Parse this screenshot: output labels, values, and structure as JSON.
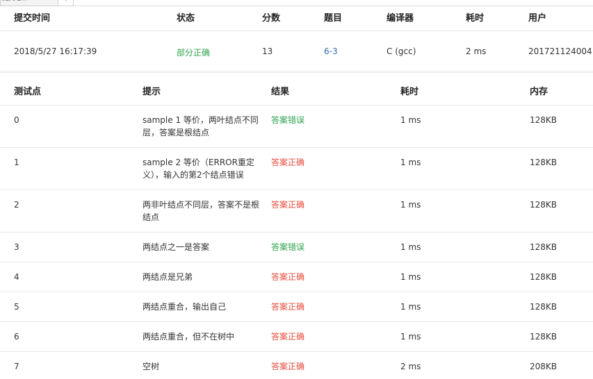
{
  "tab": {
    "label": "提交结果",
    "arrow": "‹"
  },
  "summary": {
    "headers": {
      "time": "提交时间",
      "status": "状态",
      "score": "分数",
      "problem": "题目",
      "compiler": "编译器",
      "elapsed": "耗时",
      "user": "用户"
    },
    "row": {
      "time": "2018/5/27 16:17:39",
      "status": "部分正确",
      "score": "13",
      "problem": "6-3",
      "compiler": "C (gcc)",
      "elapsed": "2 ms",
      "user": "201721124004"
    }
  },
  "cases": {
    "headers": {
      "id": "测试点",
      "hint": "提示",
      "result": "结果",
      "time": "耗时",
      "memory": "内存"
    },
    "rows": [
      {
        "id": "0",
        "hint": "sample 1 等价，两叶结点不同层，答案是根结点",
        "result": "答案错误",
        "time": "1 ms",
        "memory": "128KB"
      },
      {
        "id": "1",
        "hint": "sample 2 等价（ERROR重定义），输入的第2个结点错误",
        "result": "答案正确",
        "time": "1 ms",
        "memory": "128KB"
      },
      {
        "id": "2",
        "hint": "两非叶结点不同层，答案不是根结点",
        "result": "答案正确",
        "time": "1 ms",
        "memory": "128KB"
      },
      {
        "id": "3",
        "hint": "两结点之一是答案",
        "result": "答案错误",
        "time": "1 ms",
        "memory": "128KB"
      },
      {
        "id": "4",
        "hint": "两结点是兄弟",
        "result": "答案正确",
        "time": "1 ms",
        "memory": "128KB"
      },
      {
        "id": "5",
        "hint": "两结点重合，输出自己",
        "result": "答案正确",
        "time": "1 ms",
        "memory": "128KB"
      },
      {
        "id": "6",
        "hint": "两结点重合，但不在树中",
        "result": "答案正确",
        "time": "1 ms",
        "memory": "128KB"
      },
      {
        "id": "7",
        "hint": "空树",
        "result": "答案正确",
        "time": "2 ms",
        "memory": "208KB"
      }
    ]
  },
  "colors": {
    "correct": "#e74c3c",
    "wrong": "#2ea44f",
    "link": "#2d6db5"
  }
}
